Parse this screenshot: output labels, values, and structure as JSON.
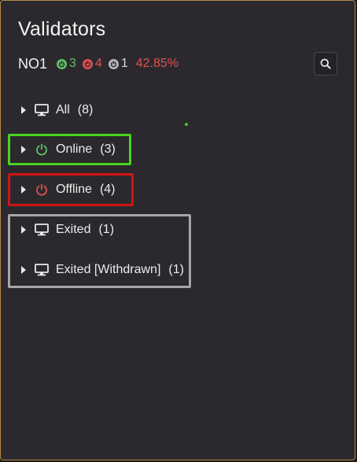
{
  "panel": {
    "title": "Validators"
  },
  "summary": {
    "node_name": "NO1",
    "online_count": "3",
    "offline_count": "4",
    "exited_count": "1",
    "percent": "42.85%"
  },
  "colors": {
    "online": "#5fbf6a",
    "offline": "#e05252",
    "exited": "#b9b9b9",
    "percent": "#e05252",
    "frame_online": "#49d41e",
    "frame_offline": "#d01414",
    "frame_exited": "#a6a6a6"
  },
  "search": {
    "icon": "search-icon"
  },
  "tree": [
    {
      "label": "All",
      "count": "(8)",
      "icon": "monitor-icon"
    },
    {
      "label": "Online",
      "count": "(3)",
      "icon": "power-icon"
    },
    {
      "label": "Offline",
      "count": "(4)",
      "icon": "power-icon"
    },
    {
      "label": "Exited",
      "count": "(1)",
      "icon": "monitor-icon"
    },
    {
      "label": "Exited [Withdrawn]",
      "count": "(1)",
      "icon": "monitor-icon"
    }
  ]
}
